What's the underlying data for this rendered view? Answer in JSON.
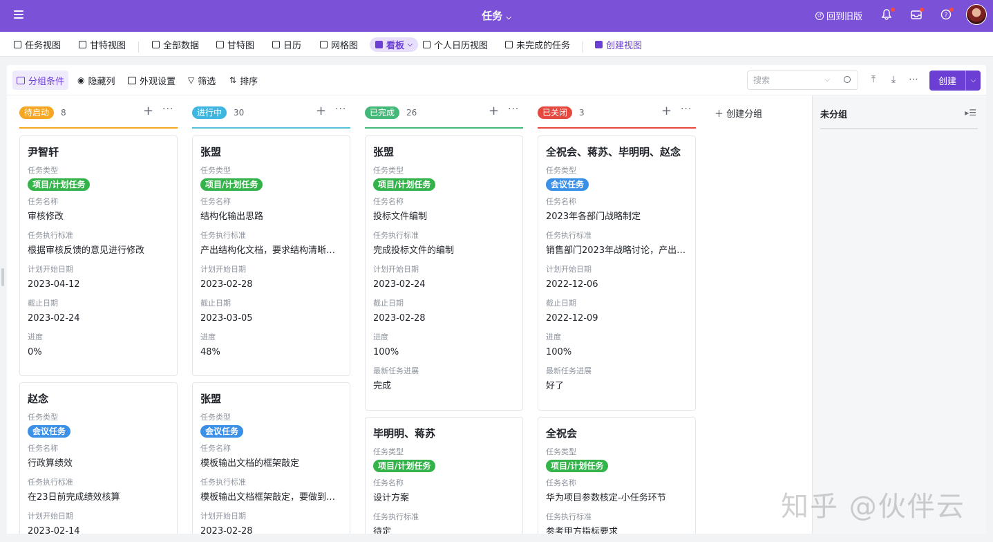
{
  "topbar": {
    "title": "任务",
    "back_old": "回到旧版"
  },
  "views": [
    {
      "label": "任务视图"
    },
    {
      "label": "甘特视图"
    },
    {
      "label": "全部数据"
    },
    {
      "label": "甘特图"
    },
    {
      "label": "日历"
    },
    {
      "label": "网格图"
    },
    {
      "label": "看板"
    },
    {
      "label": "个人日历视图"
    },
    {
      "label": "未完成的任务"
    },
    {
      "label": "创建视图"
    }
  ],
  "toolbar": {
    "group": "分组条件",
    "hide": "隐藏列",
    "appearance": "外观设置",
    "filter": "筛选",
    "sort": "排序",
    "search_placeholder": "搜索",
    "create": "创建"
  },
  "board": {
    "add_group": "创建分组",
    "ungrouped": "未分组",
    "columns": [
      {
        "tag": "待启动",
        "count": "8",
        "color": "#f5a623",
        "line": "#f5a623"
      },
      {
        "tag": "进行中",
        "count": "30",
        "color": "#3fb6e0",
        "line": "#55c0d8"
      },
      {
        "tag": "已完成",
        "count": "26",
        "color": "#43b878",
        "line": "#43b878"
      },
      {
        "tag": "已关闭",
        "count": "3",
        "color": "#e5483f",
        "line": "#e5483f"
      }
    ]
  },
  "labels": {
    "type": "任务类型",
    "name": "任务名称",
    "std": "任务执行标准",
    "start": "计划开始日期",
    "due": "截止日期",
    "progress": "进度",
    "latest": "最新任务进展"
  },
  "cards": {
    "c0a": {
      "title": "尹智轩",
      "type": "项目/计划任务",
      "name": "审核修改",
      "std": "根据审核反馈的意见进行修改",
      "start": "2023-04-12",
      "due": "2023-02-24",
      "progress": "0%"
    },
    "c0b": {
      "title": "赵念",
      "type": "会议任务",
      "name": "行政算绩效",
      "std": "在23日前完成绩效核算",
      "start": "2023-02-14"
    },
    "c1a": {
      "title": "张盟",
      "type": "项目/计划任务",
      "name": "结构化输出思路",
      "std": "产出结构化文档，要求结构清晰，...",
      "start": "2023-02-28",
      "due": "2023-03-05",
      "progress": "48%"
    },
    "c1b": {
      "title": "张盟",
      "type": "会议任务",
      "name": "模板输出文档的框架敲定",
      "std": "模板输出文档框架敲定，要做到结...",
      "start": "2023-02-28"
    },
    "c2a": {
      "title": "张盟",
      "type": "项目/计划任务",
      "name": "投标文件编制",
      "std": "完成投标文件的编制",
      "start": "2023-02-24",
      "due": "2023-02-28",
      "progress": "100%",
      "latest": "完成"
    },
    "c2b": {
      "title": "毕明明、蒋苏",
      "type": "项目/计划任务",
      "name": "设计方案",
      "std": "待定"
    },
    "c3a": {
      "title": "全祝会、蒋苏、毕明明、赵念",
      "type": "会议任务",
      "name": "2023年各部门战略制定",
      "std": "销售部门2023年战略讨论，产出2...",
      "start": "2022-12-06",
      "due": "2022-12-09",
      "progress": "100%",
      "latest": "好了"
    },
    "c3b": {
      "title": "全祝会",
      "type": "项目/计划任务",
      "name": "华为项目参数核定-小任务环节",
      "std": "参考甲方指标要求"
    }
  },
  "watermark": "知乎 @伙伴云"
}
